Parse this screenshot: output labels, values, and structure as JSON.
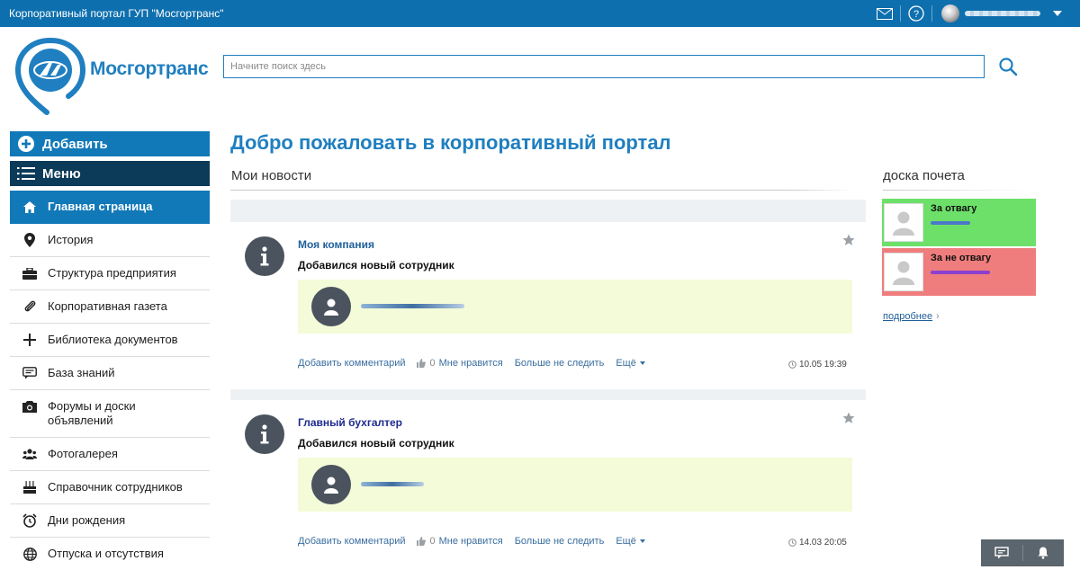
{
  "topbar": {
    "title": "Корпоративный портал ГУП \"Мосгортранс\""
  },
  "logo": {
    "brand": "Мосгортранс"
  },
  "search": {
    "placeholder": "Начните поиск здесь"
  },
  "sidebar": {
    "add_label": "Добавить",
    "menu_label": "Меню",
    "items": [
      {
        "label": "Главная страница",
        "icon": "home-icon",
        "active": true
      },
      {
        "label": "История",
        "icon": "map-pin-icon"
      },
      {
        "label": "Структура предприятия",
        "icon": "briefcase-icon"
      },
      {
        "label": "Корпоративная газета",
        "icon": "paperclip-icon"
      },
      {
        "label": "Библиотека документов",
        "icon": "plus-icon"
      },
      {
        "label": "База знаний",
        "icon": "chat-icon"
      },
      {
        "label": "Форумы и доски объявлений",
        "icon": "camera-icon"
      },
      {
        "label": "Фотогалерея",
        "icon": "users-icon"
      },
      {
        "label": "Справочник сотрудников",
        "icon": "cake-icon"
      },
      {
        "label": "Дни рождения",
        "icon": "alarm-clock-icon"
      },
      {
        "label": "Отпуска и отсутствия",
        "icon": "globe-icon"
      }
    ]
  },
  "main": {
    "welcome": "Добро пожаловать в корпоративный портал",
    "my_news": "Мои новости",
    "posts": [
      {
        "author": "Моя компания",
        "subtitle": "Добавился новый сотрудник",
        "add_comment": "Добавить комментарий",
        "like_count": "0",
        "like_label": "Мне нравится",
        "unfollow": "Больше не следить",
        "more": "Ещё",
        "time": "10.05 19:39"
      },
      {
        "author": "Главный бухгалтер",
        "subtitle": "Добавился новый сотрудник",
        "add_comment": "Добавить комментарий",
        "like_count": "0",
        "like_label": "Мне нравится",
        "unfollow": "Больше не следить",
        "more": "Ещё",
        "time": "14.03 20:05"
      }
    ]
  },
  "honor_board": {
    "title": "доска почета",
    "entries": [
      {
        "label": "За отвагу",
        "color": "#6de06a"
      },
      {
        "label": "За не отвагу",
        "color": "#ef7d7d"
      }
    ],
    "more": "подробнее"
  },
  "colors": {
    "accent": "#1279b9",
    "topbar": "#0e6fae",
    "menu_dark": "#0c3a59"
  }
}
